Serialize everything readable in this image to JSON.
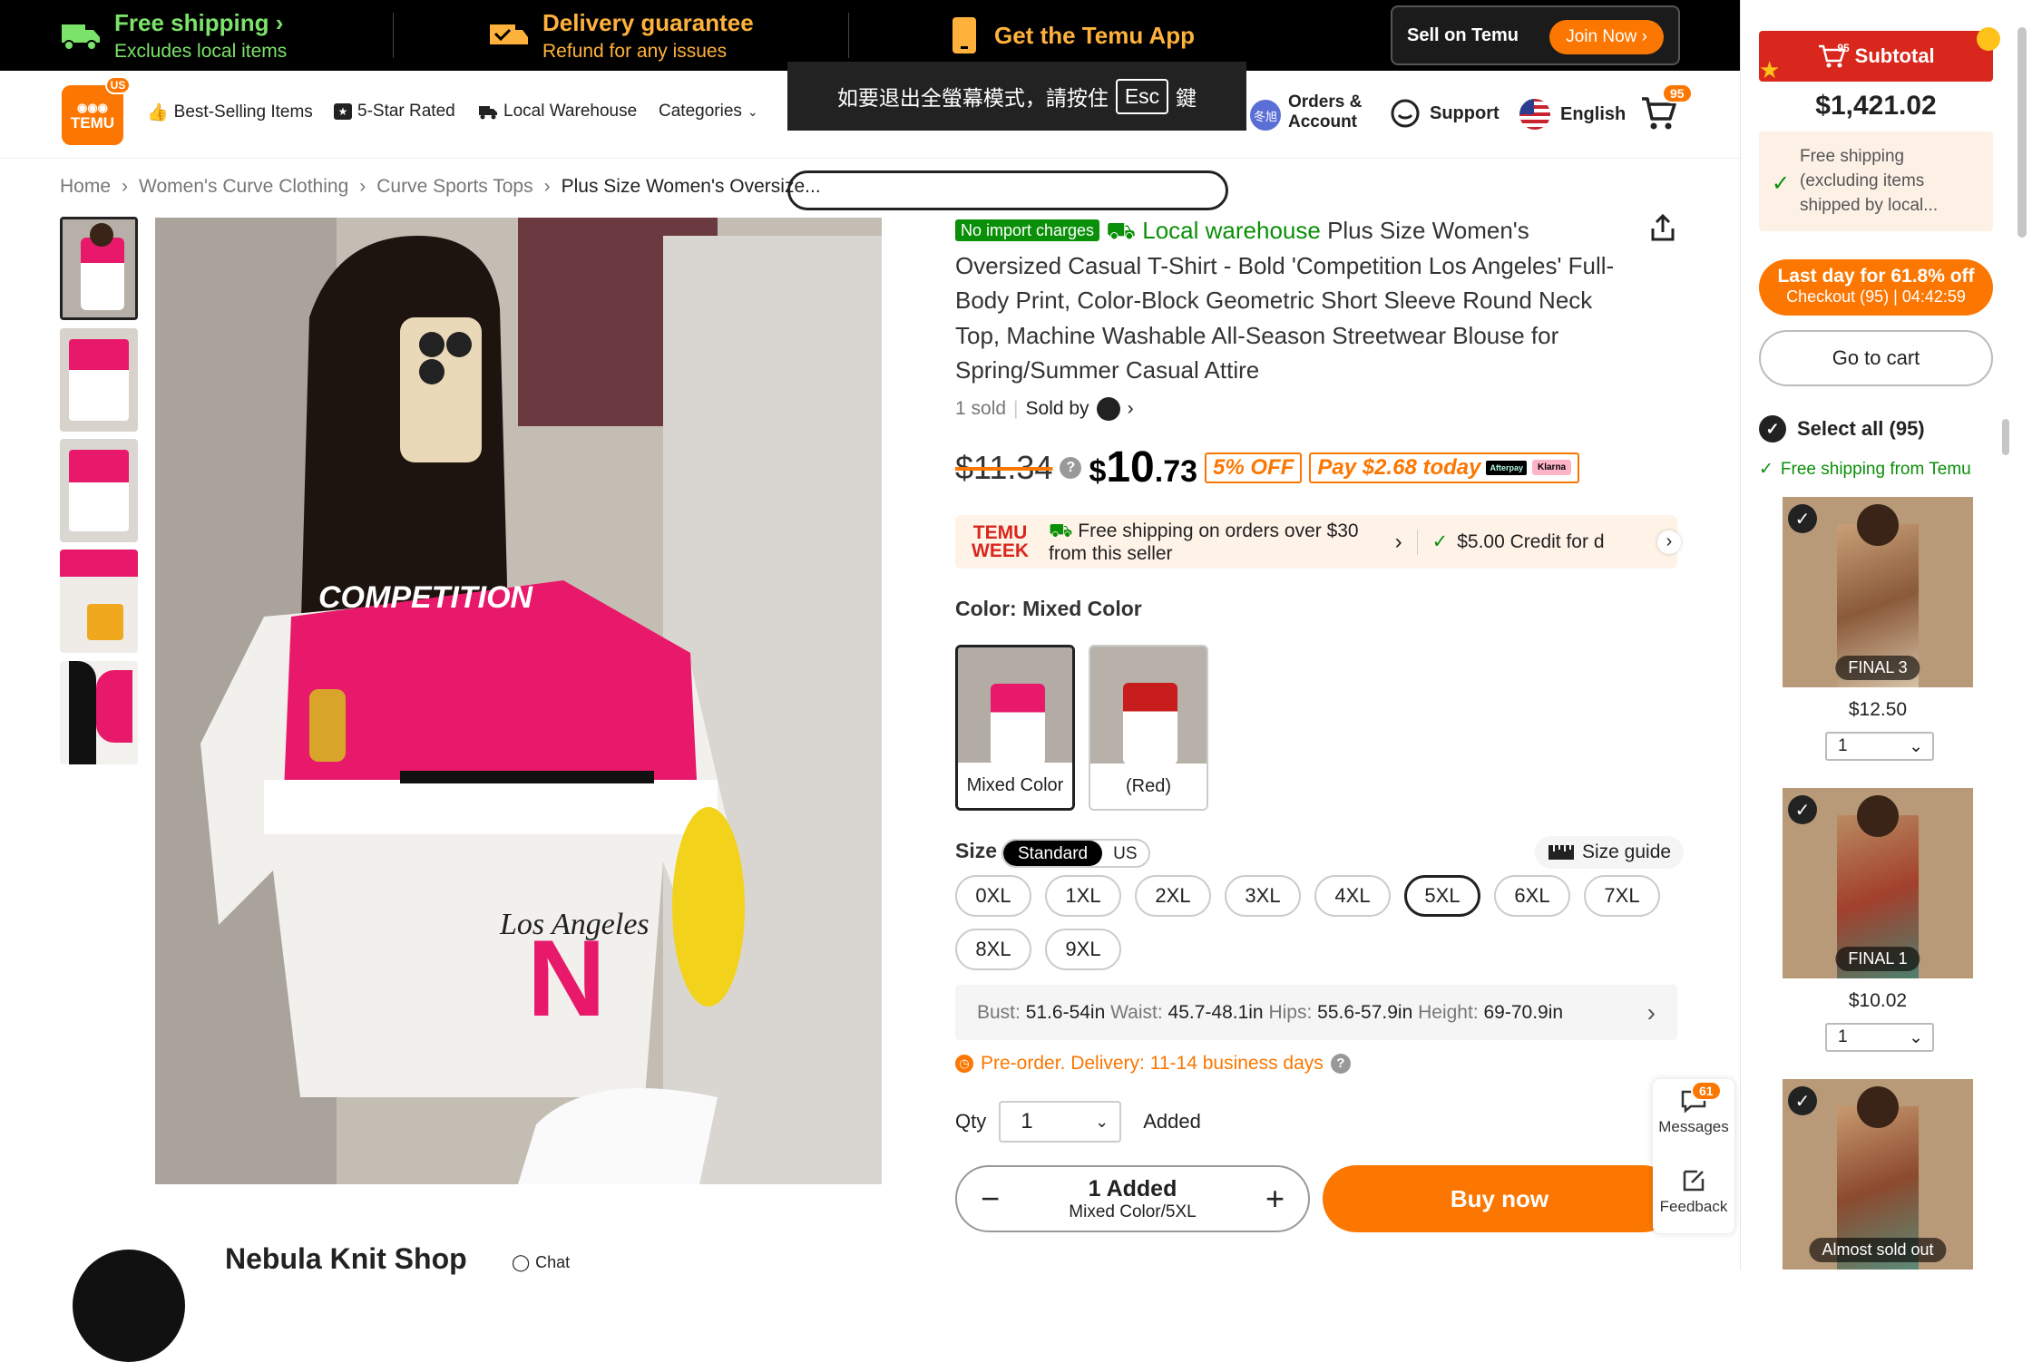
{
  "topbar": {
    "free_shipping_title": "Free shipping",
    "free_shipping_sub": "Excludes local items",
    "delivery_title": "Delivery guarantee",
    "delivery_sub": "Refund for any issues",
    "app_label": "Get the Temu App",
    "sell_label": "Sell on Temu",
    "join_label": "Join Now"
  },
  "header": {
    "logo_text": "TEMU",
    "logo_badge": "US",
    "nav": [
      "Best-Selling Items",
      "5-Star Rated",
      "Local Warehouse",
      "Categories"
    ],
    "fullscreen_notice": "如要退出全螢幕模式，請按住",
    "fullscreen_key": "Esc",
    "fullscreen_suffix": "鍵",
    "orders_line1": "Orders &",
    "orders_line2": "Account",
    "avatar_text": "冬旭",
    "support_label": "Support",
    "language_label": "English",
    "cart_count": "95"
  },
  "breadcrumb": [
    "Home",
    "Women's Curve Clothing",
    "Curve Sports Tops",
    "Plus Size Women's Oversize..."
  ],
  "product": {
    "tag_no_import": "No import charges",
    "local_warehouse": "Local warehouse",
    "title": "Plus Size Women's Oversized Casual T-Shirt - Bold 'Competition Los Angeles' Full-Body Print, Color-Block Geometric Short Sleeve Round Neck Top, Machine Washable All-Season Streetwear Blouse for Spring/Summer Casual Attire",
    "sold": "1 sold",
    "sold_by": "Sold by",
    "old_price": "$11.34",
    "price_symbol": "$",
    "price_whole": "10",
    "price_cents": ".73",
    "off_label": "5% OFF",
    "pay_today": "Pay $2.68 today",
    "afterpay": "Afterpay",
    "klarna": "Klarna",
    "promo_week_line1": "TEMU",
    "promo_week_line2": "WEEK",
    "promo_free_ship_line1": "Free shipping on orders over $30",
    "promo_free_ship_line2": "from this seller",
    "promo_credit": "$5.00 Credit for d",
    "color_label": "Color: Mixed Color",
    "colors": [
      "Mixed Color",
      "(Red)"
    ],
    "size_label": "Size",
    "size_toggle": [
      "Standard",
      "US"
    ],
    "size_guide": "Size guide",
    "sizes": [
      "0XL",
      "1XL",
      "2XL",
      "3XL",
      "4XL",
      "5XL",
      "6XL",
      "7XL",
      "8XL",
      "9XL"
    ],
    "selected_size": "5XL",
    "measure": {
      "bust_label": "Bust:",
      "bust": "51.6-54in",
      "waist_label": "Waist:",
      "waist": "45.7-48.1in",
      "hips_label": "Hips:",
      "hips": "55.6-57.9in",
      "height_label": "Height:",
      "height": "69-70.9in"
    },
    "preorder": "Pre-order. Delivery: 11-14 business days",
    "qty_label": "Qty",
    "qty_value": "1",
    "added_label": "Added",
    "stepper_count": "1 Added",
    "stepper_variant": "Mixed Color/5XL",
    "buy_now": "Buy now",
    "shop_name": "Nebula Knit Shop",
    "chat_label": "Chat",
    "image_print": {
      "word": "COMPETITION",
      "script": "Los Angeles",
      "letter": "N"
    }
  },
  "float_tools": {
    "messages_label": "Messages",
    "messages_badge": "61",
    "feedback_label": "Feedback"
  },
  "cart": {
    "subtotal_label": "Subtotal",
    "subtotal_badge": "95",
    "total": "$1,421.02",
    "free_shipping_note": "Free shipping (excluding items shipped by local...",
    "lastday_title": "Last day for 61.8% off",
    "lastday_sub": "Checkout (95) | 04:42:59",
    "goto_cart": "Go to cart",
    "select_all": "Select all (95)",
    "free_ship_from": "Free shipping from Temu",
    "items": [
      {
        "overlay": "FINAL 3",
        "price": "$12.50",
        "qty": "1"
      },
      {
        "overlay": "FINAL 1",
        "price": "$10.02",
        "qty": "1"
      },
      {
        "overlay": "Almost sold out",
        "price": "",
        "qty": ""
      }
    ]
  },
  "colors": {
    "brand_orange": "#fb7701",
    "green": "#0a8f08",
    "topbar_green": "#7be36a",
    "red": "#d9271d"
  }
}
